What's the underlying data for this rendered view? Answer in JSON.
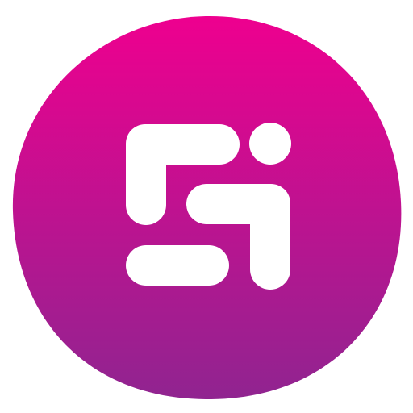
{
  "icon": {
    "name": "app-logo-icon",
    "gradient_top": "#EE008F",
    "gradient_bottom": "#902490",
    "glyph_color": "#FFFFFF",
    "background": "#FFFFFF"
  }
}
